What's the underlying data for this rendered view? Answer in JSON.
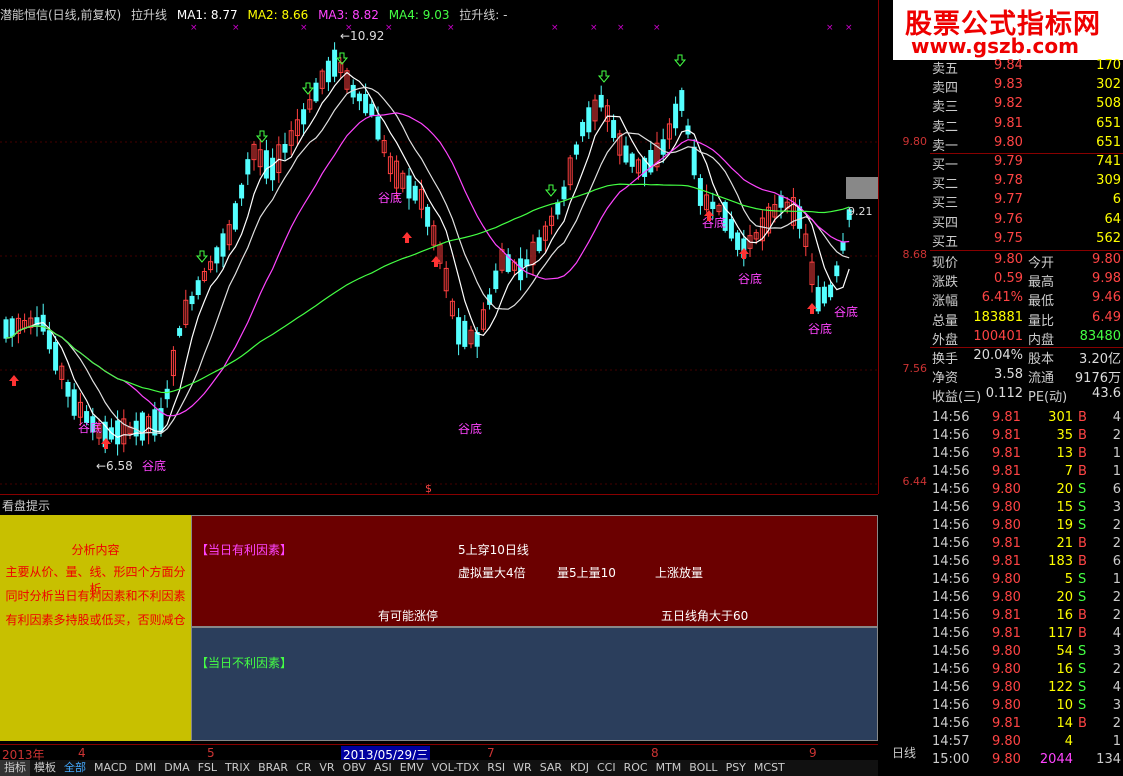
{
  "header": {
    "title": "潜能恒信(日线,前复权)",
    "indicator": "拉升线",
    "ma1": "MA1: 8.77",
    "ma2": "MA2: 8.66",
    "ma3": "MA3: 8.82",
    "ma4": "MA4: 9.03",
    "indicator2": "拉升线: -"
  },
  "colors": {
    "ma1": "#ffffff",
    "ma2": "#ffff00",
    "ma3": "#ff44ff",
    "ma4": "#44ff44"
  },
  "chart": {
    "high_label": "10.92",
    "low_label": "6.58",
    "last_label": "9.21",
    "price_ticks": [
      "9.80",
      "8.68",
      "7.56",
      "6.44"
    ],
    "markers": [
      "谷底",
      "谷底",
      "谷底",
      "谷底",
      "谷底",
      "谷底",
      "谷底",
      "谷底"
    ],
    "dollar": "$"
  },
  "logo": {
    "line1": "股票公式指标网",
    "line2": "www.gszb.com"
  },
  "orderbook": [
    {
      "label": "卖五",
      "price": "9.84",
      "vol": "170"
    },
    {
      "label": "卖四",
      "price": "9.83",
      "vol": "302"
    },
    {
      "label": "卖三",
      "price": "9.82",
      "vol": "508"
    },
    {
      "label": "卖二",
      "price": "9.81",
      "vol": "651"
    },
    {
      "label": "卖一",
      "price": "9.80",
      "vol": "651"
    },
    {
      "label": "买一",
      "price": "9.79",
      "vol": "741"
    },
    {
      "label": "买二",
      "price": "9.78",
      "vol": "309"
    },
    {
      "label": "买三",
      "price": "9.77",
      "vol": "6"
    },
    {
      "label": "买四",
      "price": "9.76",
      "vol": "64"
    },
    {
      "label": "买五",
      "price": "9.75",
      "vol": "562"
    }
  ],
  "stats": [
    {
      "l1": "现价",
      "v1": "9.80",
      "l2": "今开",
      "v2": "9.80"
    },
    {
      "l1": "涨跌",
      "v1": "0.59",
      "l2": "最高",
      "v2": "9.98"
    },
    {
      "l1": "涨幅",
      "v1": "6.41%",
      "l2": "最低",
      "v2": "9.46"
    },
    {
      "l1": "总量",
      "v1": "183881",
      "l2": "量比",
      "v2": "6.49"
    },
    {
      "l1": "外盘",
      "v1": "100401",
      "l2": "内盘",
      "v2": "83480"
    },
    {
      "l1": "换手",
      "v1": "20.04%",
      "l2": "股本",
      "v2": "3.20亿"
    },
    {
      "l1": "净资",
      "v1": "3.58",
      "l2": "流通",
      "v2": "9176万"
    },
    {
      "l1": "收益(三)",
      "v1": "0.112",
      "l2": "PE(动)",
      "v2": "43.6"
    }
  ],
  "ticks": [
    {
      "t": "14:56",
      "p": "9.81",
      "v": "301",
      "d": "B",
      "n": "4"
    },
    {
      "t": "14:56",
      "p": "9.81",
      "v": "35",
      "d": "B",
      "n": "2"
    },
    {
      "t": "14:56",
      "p": "9.81",
      "v": "13",
      "d": "B",
      "n": "1"
    },
    {
      "t": "14:56",
      "p": "9.81",
      "v": "7",
      "d": "B",
      "n": "1"
    },
    {
      "t": "14:56",
      "p": "9.80",
      "v": "20",
      "d": "S",
      "n": "6"
    },
    {
      "t": "14:56",
      "p": "9.80",
      "v": "15",
      "d": "S",
      "n": "3"
    },
    {
      "t": "14:56",
      "p": "9.80",
      "v": "19",
      "d": "S",
      "n": "2"
    },
    {
      "t": "14:56",
      "p": "9.81",
      "v": "21",
      "d": "B",
      "n": "2"
    },
    {
      "t": "14:56",
      "p": "9.81",
      "v": "183",
      "d": "B",
      "n": "6"
    },
    {
      "t": "14:56",
      "p": "9.80",
      "v": "5",
      "d": "S",
      "n": "1"
    },
    {
      "t": "14:56",
      "p": "9.80",
      "v": "20",
      "d": "S",
      "n": "2"
    },
    {
      "t": "14:56",
      "p": "9.81",
      "v": "16",
      "d": "B",
      "n": "2"
    },
    {
      "t": "14:56",
      "p": "9.81",
      "v": "117",
      "d": "B",
      "n": "4"
    },
    {
      "t": "14:56",
      "p": "9.80",
      "v": "54",
      "d": "S",
      "n": "3"
    },
    {
      "t": "14:56",
      "p": "9.80",
      "v": "16",
      "d": "S",
      "n": "2"
    },
    {
      "t": "14:56",
      "p": "9.80",
      "v": "122",
      "d": "S",
      "n": "4"
    },
    {
      "t": "14:56",
      "p": "9.80",
      "v": "10",
      "d": "S",
      "n": "3"
    },
    {
      "t": "14:56",
      "p": "9.81",
      "v": "14",
      "d": "B",
      "n": "2"
    },
    {
      "t": "14:57",
      "p": "9.80",
      "v": "4",
      "d": "",
      "n": "1"
    },
    {
      "t": "15:00",
      "p": "9.80",
      "v": "2044",
      "d": "",
      "n": "134"
    }
  ],
  "lower": {
    "title": "看盘提示",
    "info_title": "分析内容",
    "info_lines": [
      "主要从价、量、线、形四个方面分析",
      "同时分析当日有利因素和不利因素",
      "有利因素多持股或低买，否则减仓"
    ],
    "pos_title": "【当日有利因素】",
    "pos_items": [
      "5上穿10日线",
      "虚拟量大4倍",
      "量5上量10",
      "上涨放量",
      "有可能涨停",
      "五日线角大于60"
    ],
    "neg_title": "【当日不利因素】"
  },
  "datebar": {
    "items": [
      "2013年",
      "4",
      "5",
      "2013/05/29/三",
      "7",
      "8",
      "9"
    ],
    "period": "日线"
  },
  "tabs": [
    "指标",
    "模板",
    "全部",
    "MACD",
    "DMI",
    "DMA",
    "FSL",
    "TRIX",
    "BRAR",
    "CR",
    "VR",
    "OBV",
    "ASI",
    "EMV",
    "VOL-TDX",
    "RSI",
    "WR",
    "SAR",
    "KDJ",
    "CCI",
    "ROC",
    "MTM",
    "BOLL",
    "PSY",
    "MCST"
  ]
}
